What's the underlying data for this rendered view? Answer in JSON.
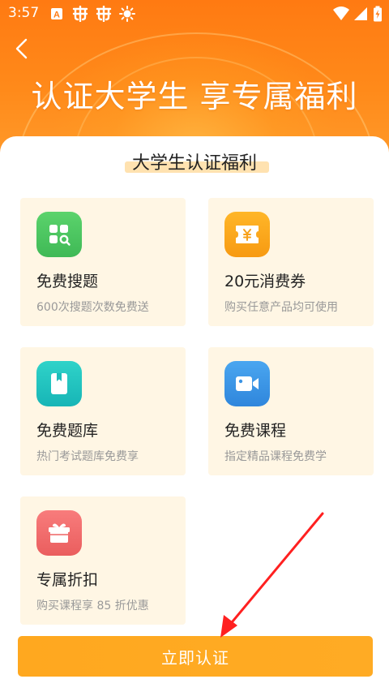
{
  "status_bar": {
    "time": "3:57",
    "notification_icons": [
      "a-box-icon",
      "bug-icon",
      "bug-icon",
      "sun-icon"
    ],
    "system_icons": [
      "wifi-icon",
      "signal-icon",
      "battery-charging-icon"
    ]
  },
  "header": {
    "back_icon": "chevron-left-icon",
    "title": "认证大学生 享专属福利",
    "colors": {
      "primary": "#ff7a12",
      "accent": "#ff9a2a"
    }
  },
  "benefits": {
    "section_title": "大学生认证福利",
    "items": [
      {
        "icon": "grid-search-icon",
        "icon_color": "#4cc661",
        "title": "免费搜题",
        "description": "600次搜题次数免费送"
      },
      {
        "icon": "ticket-yen-icon",
        "icon_color": "#f9a31a",
        "title": "20元消费券",
        "description": "购买任意产品均可使用"
      },
      {
        "icon": "book-icon",
        "icon_color": "#22c5c0",
        "title": "免费题库",
        "description": "热门考试题库免费享"
      },
      {
        "icon": "video-camera-icon",
        "icon_color": "#3a97e6",
        "title": "免费课程",
        "description": "指定精品课程免费学"
      },
      {
        "icon": "gift-icon",
        "icon_color": "#f06a6a",
        "title": "专属折扣",
        "description": "购买课程享 85 折优惠"
      }
    ]
  },
  "action": {
    "verify_label": "立即认证",
    "color": "#ffa81f"
  },
  "annotation": {
    "arrow_color": "#ff2020"
  }
}
